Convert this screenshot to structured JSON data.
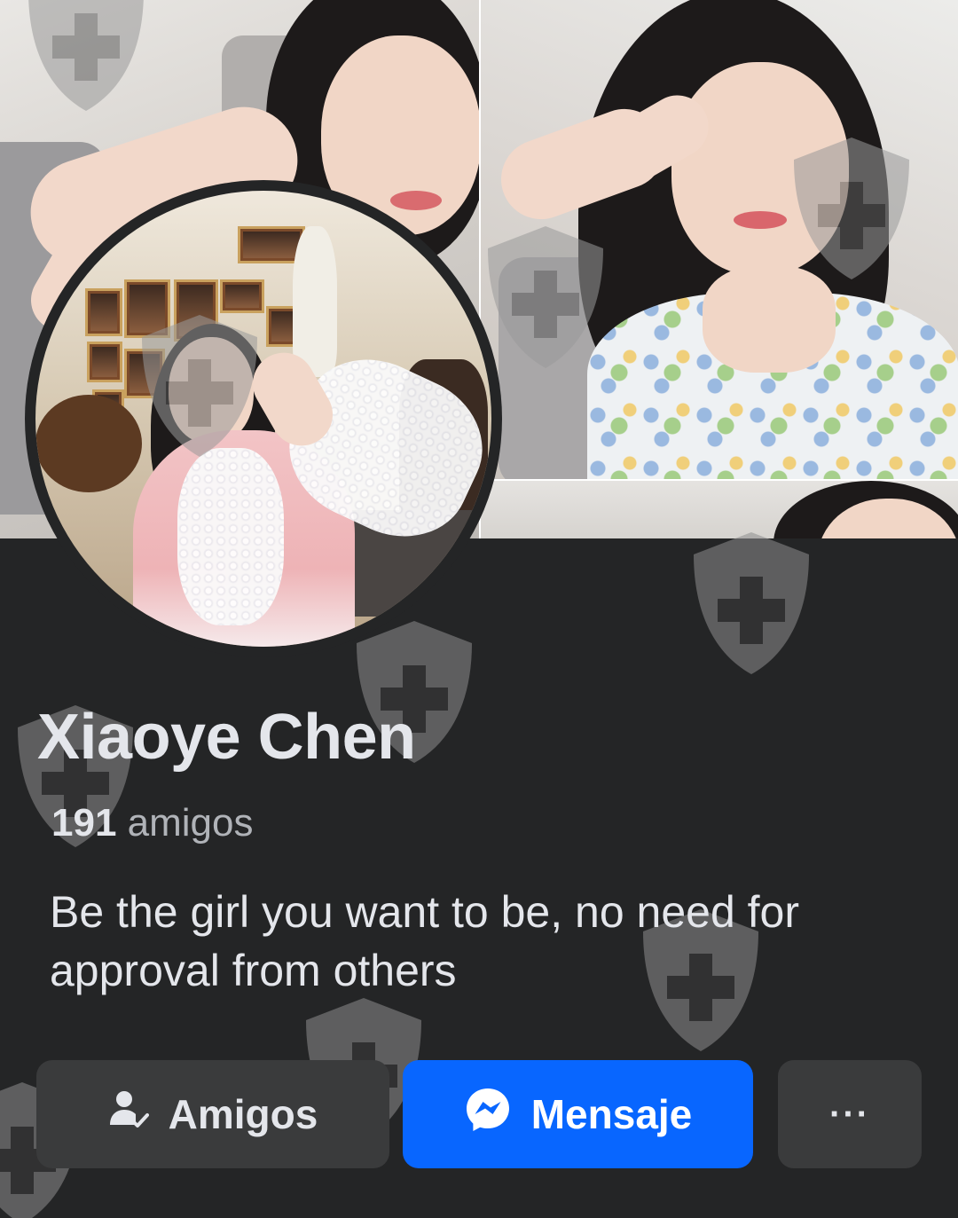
{
  "profile": {
    "name": "Xiaoye Chen",
    "friends_count": "191",
    "friends_label": "amigos",
    "bio": "Be the girl you want to be, no need for approval from others"
  },
  "actions": {
    "friends_label": "Amigos",
    "message_label": "Mensaje",
    "more_label": "···"
  },
  "colors": {
    "background": "#242526",
    "primary_button": "#0866ff",
    "secondary_button": "#3a3b3c",
    "text_primary": "#e4e6eb",
    "text_secondary": "#b0b3b8"
  },
  "icons": {
    "friends": "person-check-icon",
    "message": "messenger-icon",
    "more": "more-dots-icon",
    "watermark": "shield-plus-icon"
  }
}
